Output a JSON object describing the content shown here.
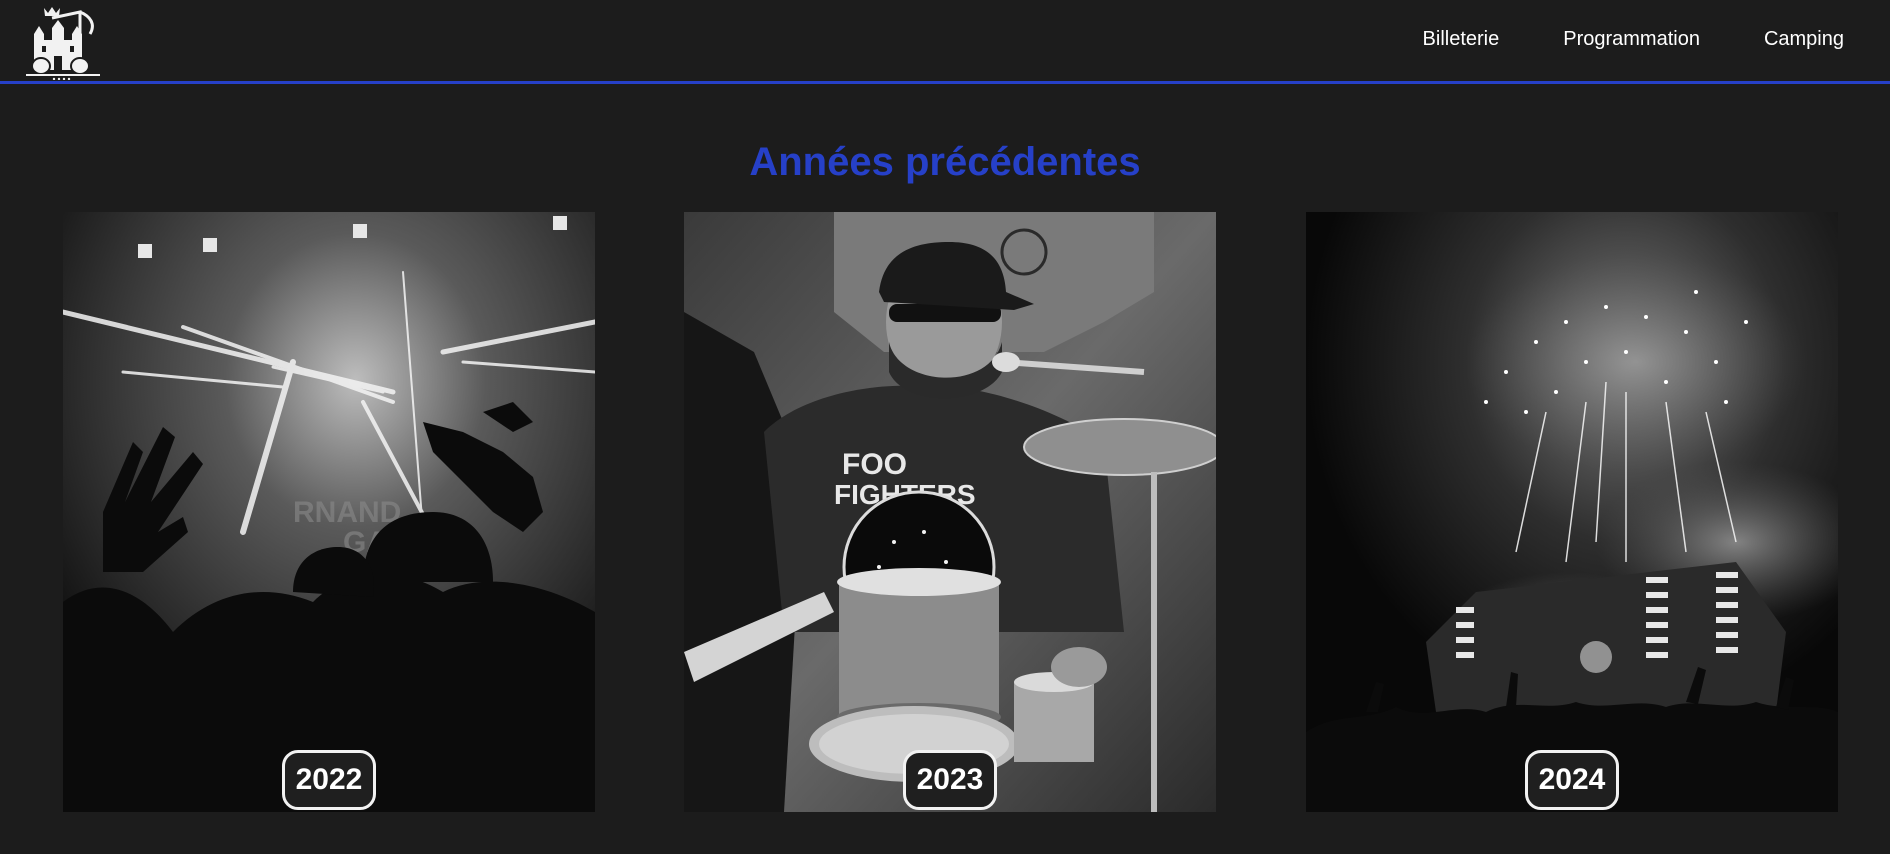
{
  "header": {
    "logo_icon": "castle-music-logo",
    "accent_color": "#2640c8",
    "nav": [
      {
        "label": "Billeterie"
      },
      {
        "label": "Programmation"
      },
      {
        "label": "Camping"
      }
    ]
  },
  "main": {
    "title": "Années précédentes",
    "title_color": "#2640c8",
    "cards": [
      {
        "year": "2022",
        "image": "concert-crowd-stage-lights-photo"
      },
      {
        "year": "2023",
        "image": "drummer-foo-fighters-shirt-photo"
      },
      {
        "year": "2024",
        "image": "fireworks-over-festival-stage-photo"
      }
    ]
  }
}
